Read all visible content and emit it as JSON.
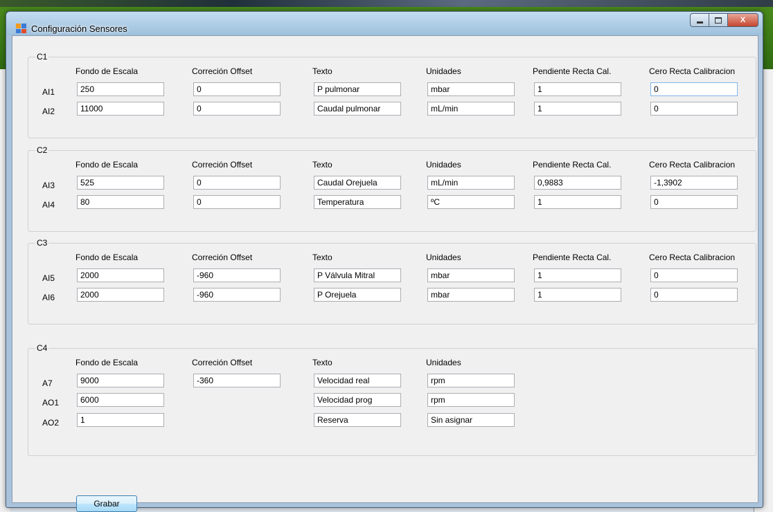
{
  "window": {
    "title": "Configuración Sensores",
    "close_glyph": "X"
  },
  "groups": [
    {
      "legend": "C1",
      "headers": [
        "Fondo de Escala",
        "Correción Offset",
        "Texto",
        "Unidades",
        "Pendiente Recta Cal.",
        "Cero Recta Calibracion"
      ],
      "rows": [
        {
          "label": "AI1",
          "fondo": "250",
          "offset": "0",
          "texto": "P pulmonar",
          "unidades": "mbar",
          "pendiente": "1",
          "cero": "0"
        },
        {
          "label": "AI2",
          "fondo": "11000",
          "offset": "0",
          "texto": "Caudal pulmonar",
          "unidades": "mL/min",
          "pendiente": "1",
          "cero": "0"
        }
      ]
    },
    {
      "legend": "C2",
      "headers": [
        "Fondo de Escala",
        "Correción Offset",
        "Texto",
        "Unidades",
        "Pendiente Recta Cal.",
        "Cero Recta Calibracion"
      ],
      "rows": [
        {
          "label": "AI3",
          "fondo": "525",
          "offset": "0",
          "texto": "Caudal Orejuela",
          "unidades": "mL/min",
          "pendiente": "0,9883",
          "cero": "-1,3902"
        },
        {
          "label": "AI4",
          "fondo": "80",
          "offset": "0",
          "texto": "Temperatura",
          "unidades": "ºC",
          "pendiente": "1",
          "cero": "0"
        }
      ]
    },
    {
      "legend": "C3",
      "headers": [
        "Fondo de Escala",
        "Correción Offset",
        "Texto",
        "Unidades",
        "Pendiente Recta Cal.",
        "Cero Recta Calibracion"
      ],
      "rows": [
        {
          "label": "AI5",
          "fondo": "2000",
          "offset": "-960",
          "texto": "P Válvula Mitral",
          "unidades": "mbar",
          "pendiente": "1",
          "cero": "0"
        },
        {
          "label": "AI6",
          "fondo": "2000",
          "offset": "-960",
          "texto": "P Orejuela",
          "unidades": "mbar",
          "pendiente": "1",
          "cero": "0"
        }
      ]
    },
    {
      "legend": "C4",
      "headers": [
        "Fondo de Escala",
        "Correción Offset",
        "Texto",
        "Unidades"
      ],
      "rows": [
        {
          "label": "A7",
          "fondo": "9000",
          "offset": "-360",
          "texto": "Velocidad real",
          "unidades": "rpm"
        },
        {
          "label": "AO1",
          "fondo": "6000",
          "texto": "Velocidad prog",
          "unidades": "rpm"
        },
        {
          "label": "AO2",
          "fondo": "1",
          "texto": "Reserva",
          "unidades": "Sin asignar"
        }
      ]
    }
  ],
  "buttons": {
    "grabar": "Grabar"
  }
}
